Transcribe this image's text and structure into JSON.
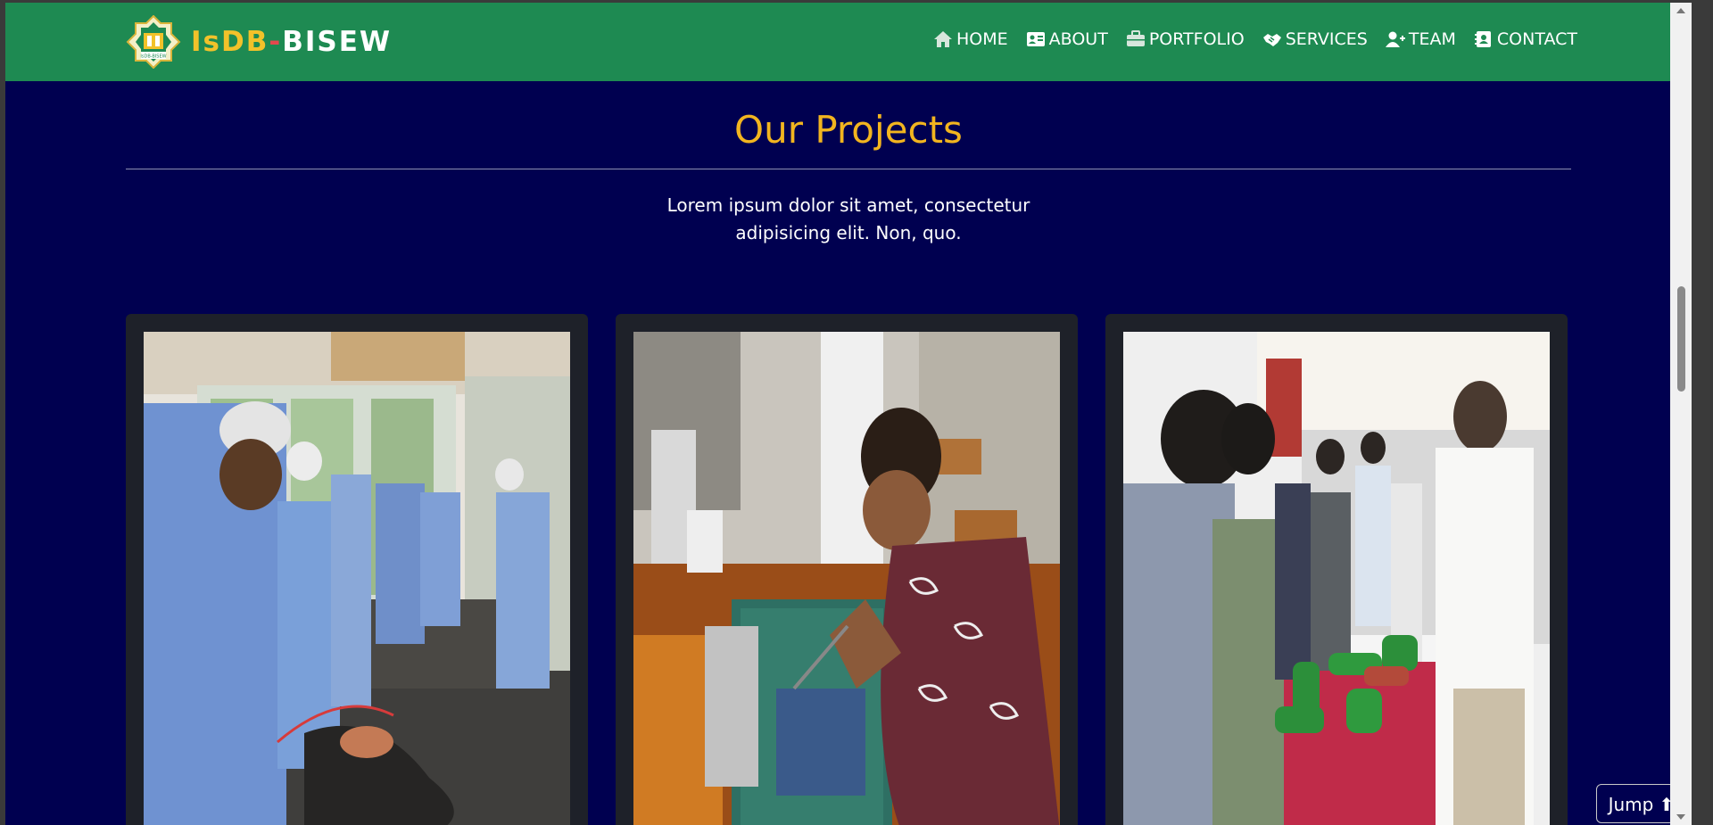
{
  "brand": {
    "part1": "IsDB",
    "separator": "-",
    "part2": "BISEW",
    "logo_icon": "isdb-bisew-logo-icon",
    "logo_text": "IsDB-BISEW"
  },
  "nav": {
    "items": [
      {
        "label": "HOME",
        "icon": "home-icon"
      },
      {
        "label": "ABOUT",
        "icon": "id-card-icon"
      },
      {
        "label": "PORTFOLIO",
        "icon": "briefcase-icon"
      },
      {
        "label": "SERVICES",
        "icon": "handshake-icon"
      },
      {
        "label": "TEAM",
        "icon": "user-plus-icon"
      },
      {
        "label": "CONTACT",
        "icon": "address-book-icon"
      }
    ]
  },
  "section": {
    "title": "Our Projects",
    "subtitle_line1": "Lorem ipsum dolor sit amet, consectetur",
    "subtitle_line2": "adipisicing elit. Non, quo."
  },
  "jump_button": {
    "label": "Jump ⬆"
  },
  "colors": {
    "navbar": "#1e8a52",
    "background": "#000050",
    "title": "#f2b51f",
    "brand_yellow": "#f2c22a",
    "card": "#1e2129"
  }
}
